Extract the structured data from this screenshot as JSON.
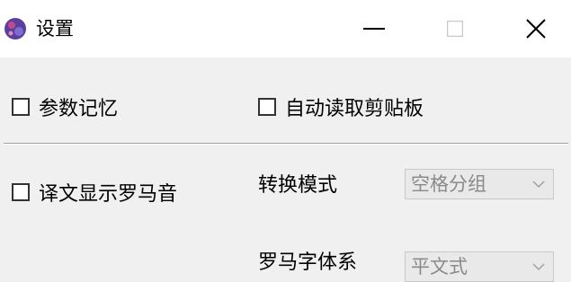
{
  "window": {
    "title": "设置",
    "icons": {
      "app": "app-icon",
      "minimize": "minimize-icon",
      "maximize": "maximize-icon",
      "close": "close-icon"
    }
  },
  "options": {
    "param_memory": {
      "label": "参数记忆",
      "checked": false
    },
    "auto_read_clipboard": {
      "label": "自动读取剪贴板",
      "checked": false
    },
    "show_romaji": {
      "label": "译文显示罗马音",
      "checked": false
    }
  },
  "convert_mode": {
    "label": "转换模式",
    "value": "空格分组",
    "disabled": true
  },
  "romaji_system": {
    "label": "罗马字体系",
    "value": "平文式",
    "disabled": true
  },
  "colors": {
    "title_bg": "#ffffff",
    "window_bg": "#f0f0f0",
    "disabled_text": "#8a8a8a"
  }
}
